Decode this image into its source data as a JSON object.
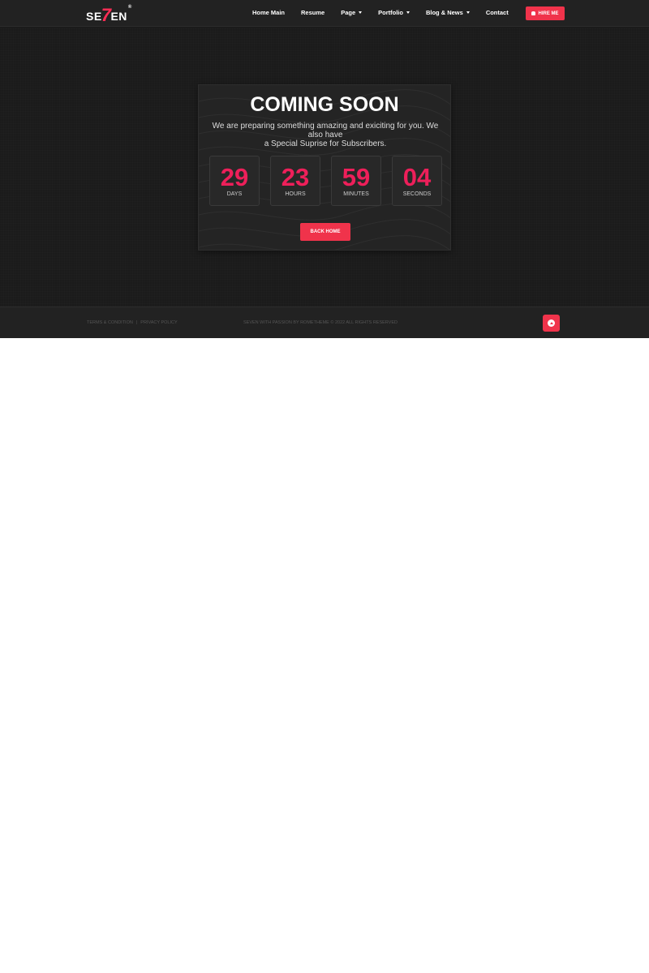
{
  "header": {
    "logo": {
      "left": "SE",
      "seven": "7",
      "right": "EN",
      "reg": "®"
    },
    "nav": [
      {
        "label": "Home Main",
        "dropdown": false
      },
      {
        "label": "Resume",
        "dropdown": false
      },
      {
        "label": "Page",
        "dropdown": true
      },
      {
        "label": "Portfolio",
        "dropdown": true
      },
      {
        "label": "Blog & News",
        "dropdown": true
      },
      {
        "label": "Contact",
        "dropdown": false
      }
    ],
    "hire_label": "HIRE ME"
  },
  "hero": {
    "title": "COMING SOON",
    "subtitle_line1": "We are preparing something amazing and exiciting for you. We also have",
    "subtitle_line2": "a Special Suprise for Subscribers.",
    "countdown": [
      {
        "value": "29",
        "label": "DAYS"
      },
      {
        "value": "23",
        "label": "HOURS"
      },
      {
        "value": "59",
        "label": "MINUTES"
      },
      {
        "value": "04",
        "label": "SECONDS"
      }
    ],
    "button_label": "BACK HOME"
  },
  "footer": {
    "terms": "TERMS & CONDITION",
    "separator": "|",
    "privacy": "PRIVACY POLICY",
    "copyright": "SEVEN WITH PASSION BY ROMETHEME © 2022 ALL RIGHTS RESERVED"
  },
  "colors": {
    "accent": "#f0334b",
    "countdown_number": "#ee1f5a",
    "background": "#1b1b1b",
    "header_bg": "#222222"
  },
  "icons": {
    "hire": "bell-icon",
    "nav_dropdown": "caret-down-icon",
    "scroll_top": "arrow-up-circle-icon"
  }
}
